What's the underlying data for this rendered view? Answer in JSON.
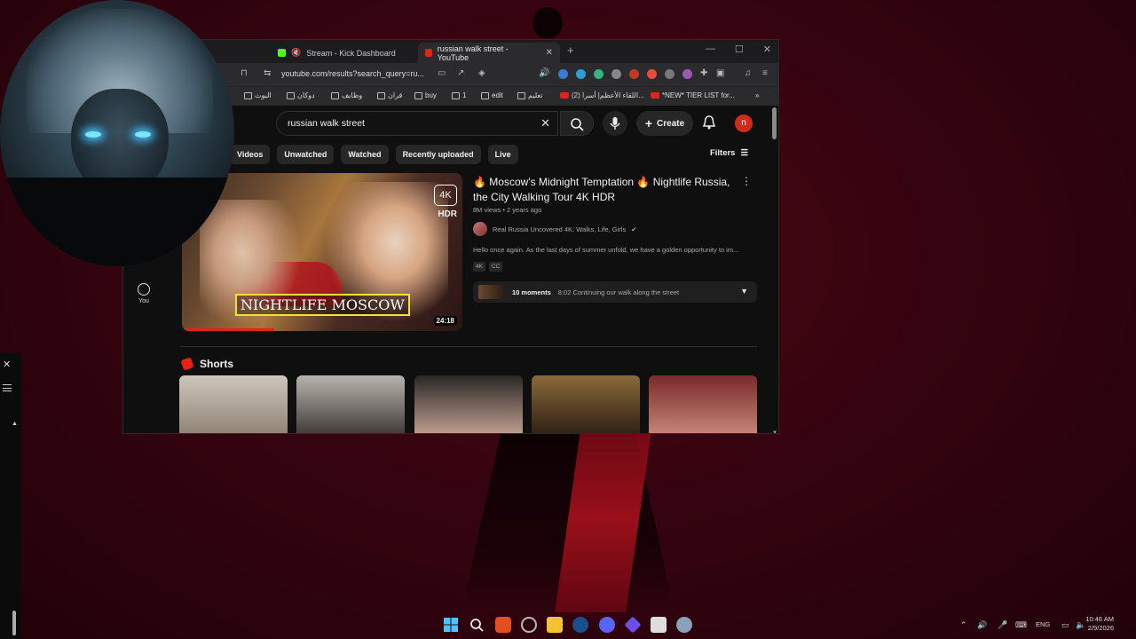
{
  "browser": {
    "tabs": [
      {
        "label": "Stream - Kick Dashboard",
        "active": false,
        "favicon": "kick-icon"
      },
      {
        "label": "russian walk street - YouTube",
        "active": true,
        "favicon": "youtube-icon"
      }
    ],
    "url": "youtube.com/results?search_query=ru...",
    "bookmarks": [
      "البوث",
      "دوكان",
      "وظايف",
      "قران",
      "buy",
      "1",
      "edit",
      "تعليم",
      "(2) اللقاء الأعظم| أسرا...",
      "*NEW* TIER LIST for..."
    ]
  },
  "youtube": {
    "search_query": "russian walk street",
    "create_label": "Create",
    "avatar_letter": "n",
    "chips": [
      "ts",
      "Videos",
      "Unwatched",
      "Watched",
      "Recently uploaded",
      "Live"
    ],
    "filters_label": "Filters",
    "you_label": "You",
    "video": {
      "title": "🔥 Moscow's Midnight Temptation 🔥 Nightlife Russia, the City Walking Tour 4K HDR",
      "meta": "8M views • 2 years ago",
      "channel": "Real Russia Uncovered 4K: Walks, Life, Girls",
      "description": "Hello once again. As the last days of summer unfold, we have a golden opportunity to im...",
      "tags": [
        "4K",
        "CC"
      ],
      "thumbnail_caption": "NIGHTLIFE MOSCOW",
      "badge_4k": "4K",
      "badge_hdr": "HDR",
      "duration": "24:18",
      "watch_progress": 0.33,
      "moments_count": "10 moments",
      "moments_text": "8:02 Continuing our walk along the street"
    },
    "shorts_label": "Shorts"
  },
  "taskbar": {
    "language": "ENG",
    "time": "10:46 AM",
    "date": "2/9/2026"
  },
  "colors": {
    "youtube_red": "#e62117",
    "accent_yellow": "#f0e23a"
  }
}
